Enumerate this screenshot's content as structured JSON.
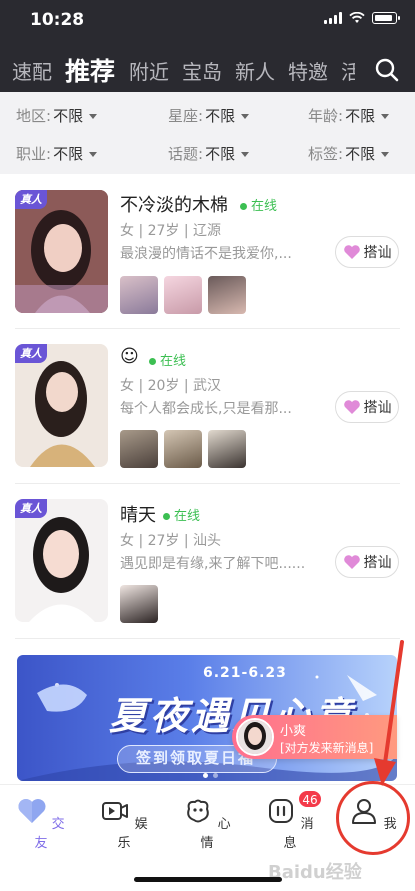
{
  "status_bar": {
    "time": "10:28"
  },
  "top_tabs": {
    "items": [
      "速配",
      "推荐",
      "附近",
      "宝岛",
      "新人",
      "特邀",
      "活"
    ],
    "active_index": 1
  },
  "filters": [
    {
      "label": "地区:",
      "value": "不限"
    },
    {
      "label": "星座:",
      "value": "不限"
    },
    {
      "label": "年龄:",
      "value": "不限"
    },
    {
      "label": "职业:",
      "value": "不限"
    },
    {
      "label": "话题:",
      "value": "不限"
    },
    {
      "label": "标签:",
      "value": "不限"
    }
  ],
  "cards": [
    {
      "badge": "真人",
      "name": "不冷淡的木棉",
      "online": "在线",
      "meta": "女 | 27岁 | 辽源",
      "bio": "最浪漫的情话不是我爱你,...",
      "greet": "搭讪"
    },
    {
      "badge": "真人",
      "name": "☺",
      "online": "在线",
      "meta": "女 | 20岁 | 武汉",
      "bio": "每个人都会成长,只是看那...",
      "greet": "搭讪"
    },
    {
      "badge": "真人",
      "name": "晴天",
      "online": "在线",
      "meta": "女 | 27岁 | 汕头",
      "bio": "遇见即是有缘,来了解下吧......",
      "greet": "搭讪"
    }
  ],
  "banner": {
    "date": "6.21-6.23",
    "title": "夏夜遇见心意",
    "subtitle": "签到领取夏日福"
  },
  "toast": {
    "name": "小爽",
    "message": "[对方发来新消息]"
  },
  "bottom_nav": {
    "items": [
      "交友",
      "娱乐",
      "心情",
      "消息",
      "我"
    ],
    "active_index": 0,
    "messages_badge": "46"
  },
  "watermark": "Baidu经验",
  "colors": {
    "header_bg": "#2a2a30",
    "accent": "#7f6de8",
    "online": "#3cbf52",
    "badge_red": "#f43a4a",
    "annotation_red": "#e53a2f"
  }
}
